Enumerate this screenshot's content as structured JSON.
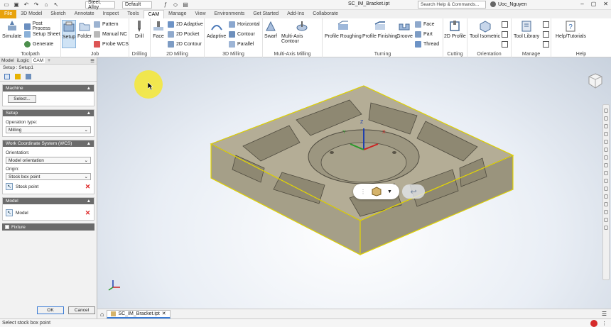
{
  "titlebar": {
    "quick_icons": [
      "file-icon",
      "save-icon",
      "undo-icon",
      "redo-icon",
      "home-icon",
      "select-icon"
    ],
    "material": "Steel, Alloy",
    "appearance": "Default",
    "document": "SC_IM_Bracket.ipt",
    "search_placeholder": "Search Help & Commands...",
    "user": "Uoc_Nguyen"
  },
  "tabs": [
    "File",
    "3D Model",
    "Sketch",
    "Annotate",
    "Inspect",
    "Tools",
    "CAM",
    "Manage",
    "View",
    "Environments",
    "Get Started",
    "Add-Ins",
    "Collaborate"
  ],
  "active_tab": "CAM",
  "ribbon": {
    "toolpath": {
      "label": "Toolpath",
      "simulate": "Simulate",
      "post_process": "Post Process",
      "setup_sheet": "Setup Sheet",
      "generate": "Generate"
    },
    "job": {
      "label": "Job",
      "setup": "Setup",
      "folder": "Folder",
      "pattern": "Pattern",
      "manual_nc": "Manual NC",
      "probe_wcs": "Probe WCS"
    },
    "drilling": {
      "label": "Drilling",
      "drill": "Drill"
    },
    "milling2d": {
      "label": "2D Milling",
      "face": "Face",
      "adaptive2d": "2D Adaptive",
      "pocket2d": "2D Pocket",
      "contour2d": "2D Contour"
    },
    "milling3d": {
      "label": "3D Milling",
      "adaptive": "Adaptive",
      "horizontal": "Horizontal",
      "contour": "Contour",
      "parallel": "Parallel"
    },
    "multiaxis": {
      "label": "Multi-Axis Milling",
      "swarf": "Swarf",
      "multi_axis_contour": "Multi-Axis Contour"
    },
    "turning": {
      "label": "Turning",
      "profile_roughing": "Profile Roughing",
      "profile_finishing": "Profile Finishing",
      "groove": "Groove",
      "face": "Face",
      "part": "Part",
      "thread": "Thread"
    },
    "cutting": {
      "label": "Cutting",
      "profile2d": "2D Profile"
    },
    "orientation": {
      "label": "Orientation",
      "tool_isometric": "Tool Isometric"
    },
    "manage": {
      "label": "Manage",
      "tool_library": "Tool Library"
    },
    "help": {
      "label": "Help",
      "help_tutorials": "Help/Tutorials"
    }
  },
  "panel": {
    "tabs": [
      "Model",
      "iLogic",
      "CAM",
      "+"
    ],
    "title": "Setup : Setup1",
    "machine": {
      "header": "Machine",
      "select_label": "Select..."
    },
    "setup": {
      "header": "Setup",
      "operation_type_label": "Operation type:",
      "operation_type": "Milling"
    },
    "wcs": {
      "header": "Work Coordinate System (WCS)",
      "orientation_label": "Orientation:",
      "orientation": "Model orientation",
      "origin_label": "Origin:",
      "origin": "Stock box point",
      "stock_point": "Stock point"
    },
    "model": {
      "header": "Model",
      "model_label": "Model"
    },
    "fixture": "Fixture",
    "ok": "OK",
    "cancel": "Cancel"
  },
  "viewport": {
    "triad_labels": {
      "x": "X",
      "y": "Y",
      "z": "Z"
    }
  },
  "doc_tab": "SC_IM_Bracket.ipt",
  "status": "Select stock box point",
  "colors": {
    "file_tab": "#e8a20c",
    "selection": "#e6d800",
    "part": "#8f8a7a"
  }
}
